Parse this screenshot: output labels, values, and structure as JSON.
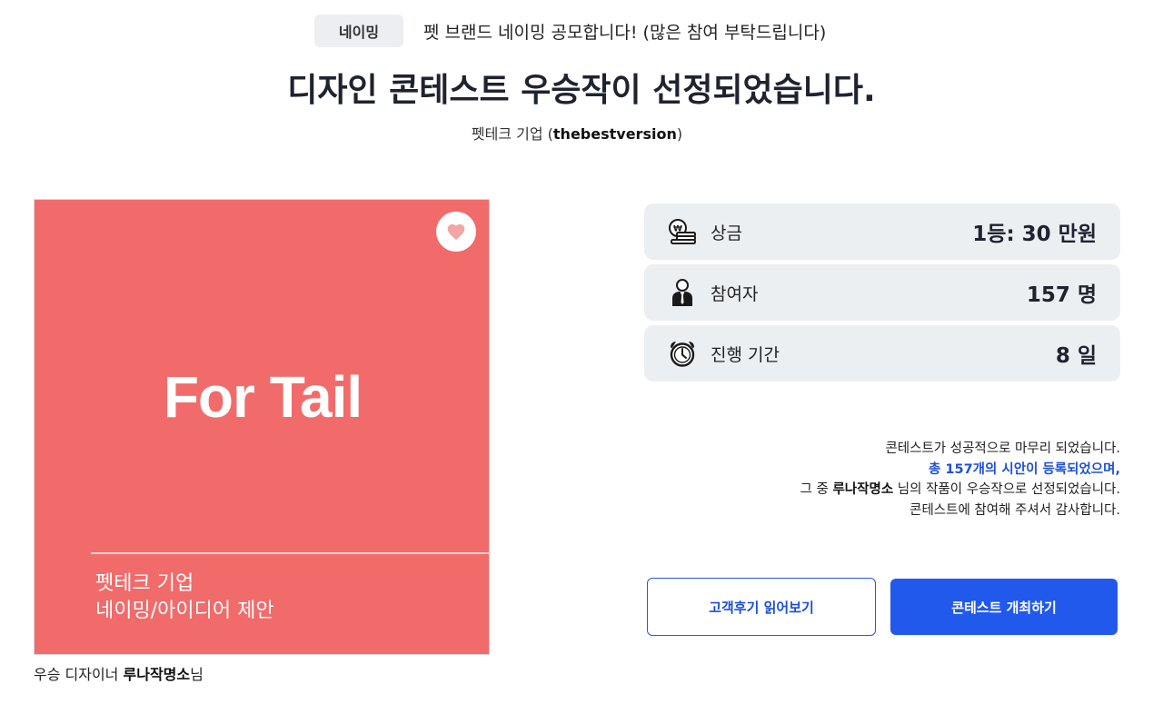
{
  "header": {
    "category_badge": "네이밍",
    "subtitle": "펫 브랜드 네이밍 공모합니다! (많은 참여 부탁드립니다)",
    "title": "디자인 콘테스트 우승작이 선정되었습니다.",
    "company_prefix": "펫테크 기업 (",
    "company_name": "thebestversion",
    "company_suffix": ")"
  },
  "winner_card": {
    "brand": "For Tail",
    "line1": "펫테크 기업",
    "line2": "네이밍/아이디어 제안",
    "background_color": "#f16b6b",
    "like_icon": "heart-icon"
  },
  "designer": {
    "prefix": "우승 디자이너 ",
    "name": "루나작명소",
    "suffix": "님"
  },
  "stats": [
    {
      "icon": "prize-money-icon",
      "label": "상금",
      "value": "1등: 30 만원"
    },
    {
      "icon": "participant-icon",
      "label": "참여자",
      "value": "157 명"
    },
    {
      "icon": "alarm-clock-icon",
      "label": "진행 기간",
      "value": "8 일"
    }
  ],
  "result": {
    "line1": "콘테스트가 성공적으로 마무리 되었습니다.",
    "line2": "총 157개의 시안이 등록되었으며,",
    "line3_prefix": "그 중 ",
    "line3_name": "루나작명소",
    "line3_suffix": " 님의 작품이 우승작으로 선정되었습니다.",
    "line4": "콘테스트에 참여해 주셔서 감사합니다."
  },
  "buttons": {
    "reviews": "고객후기 읽어보기",
    "host": "콘테스트 개최하기"
  },
  "colors": {
    "accent": "#2159ec",
    "highlight_text": "#1d4fd8"
  }
}
